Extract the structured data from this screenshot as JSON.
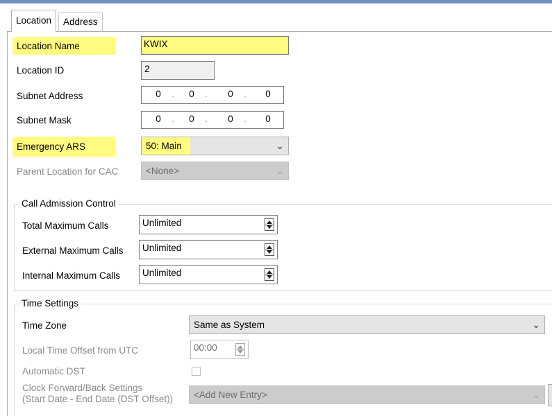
{
  "tabs": [
    {
      "label": "Location",
      "active": true
    },
    {
      "label": "Address",
      "active": false
    }
  ],
  "fields": {
    "location_name": {
      "label": "Location Name",
      "value": "KWIX"
    },
    "location_id": {
      "label": "Location ID",
      "value": "2"
    },
    "subnet_address": {
      "label": "Subnet Address",
      "octets": [
        "0",
        "0",
        "0",
        "0"
      ]
    },
    "subnet_mask": {
      "label": "Subnet Mask",
      "octets": [
        "0",
        "0",
        "0",
        "0"
      ]
    },
    "emergency_ars": {
      "label": "Emergency ARS",
      "value": "50: Main"
    },
    "parent_location": {
      "label": "Parent Location for CAC",
      "value": "<None>"
    }
  },
  "call_admission": {
    "title": "Call Admission Control",
    "total_max": {
      "label": "Total Maximum Calls",
      "value": "Unlimited"
    },
    "external_max": {
      "label": "External Maximum Calls",
      "value": "Unlimited"
    },
    "internal_max": {
      "label": "Internal Maximum Calls",
      "value": "Unlimited"
    }
  },
  "time_settings": {
    "title": "Time Settings",
    "time_zone": {
      "label": "Time Zone",
      "value": "Same as System"
    },
    "local_offset": {
      "label": "Local Time Offset from UTC",
      "value": "00:00"
    },
    "auto_dst": {
      "label": "Automatic DST",
      "checked": false
    },
    "clock_settings": {
      "label_line1": "Clock Forward/Back Settings",
      "label_line2": "(Start Date - End Date (DST Offset))",
      "value": "<Add New Entry>"
    }
  },
  "colors": {
    "highlight": "#fffb80",
    "title_bar": "#6d8fbd"
  },
  "icons": {
    "dropdown": "chevron-down-icon",
    "spinner": "spin-updown-icon"
  }
}
